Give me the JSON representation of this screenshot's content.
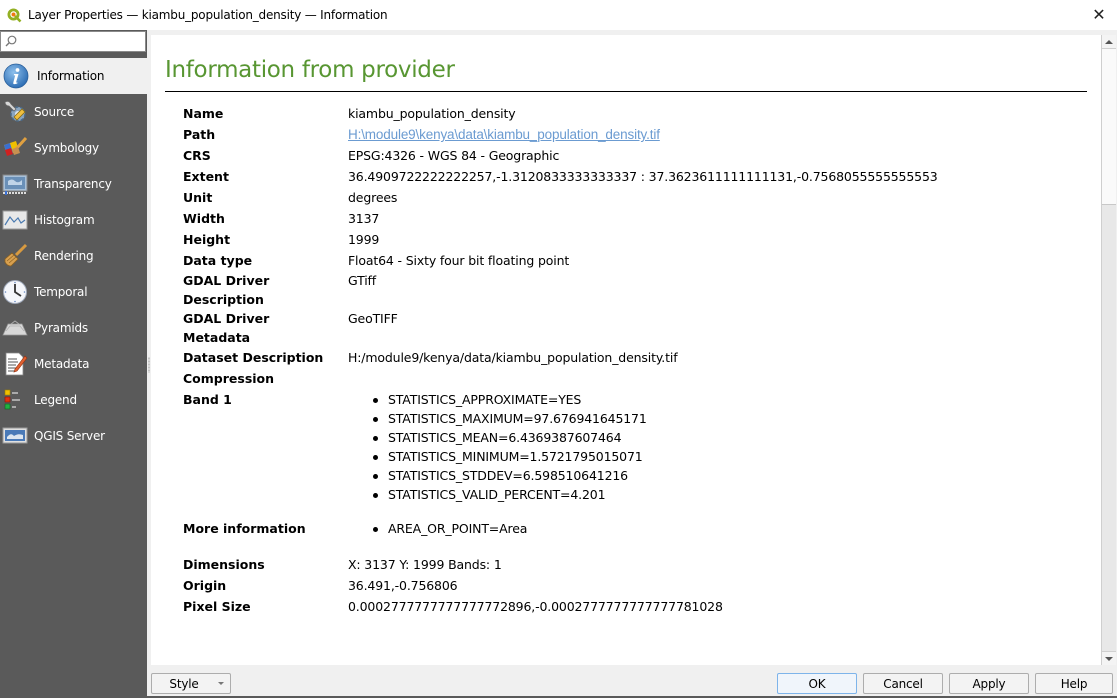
{
  "window": {
    "title": "Layer Properties — kiambu_population_density — Information",
    "app_icon": "qgis-logo-icon",
    "close_icon": "close-icon",
    "close_glyph": "✕"
  },
  "sidebar": {
    "search": {
      "placeholder": "",
      "value": "",
      "icon": "search-icon"
    },
    "items": [
      {
        "label": "Information",
        "icon": "information-icon",
        "selected": true
      },
      {
        "label": "Source",
        "icon": "source-icon",
        "selected": false
      },
      {
        "label": "Symbology",
        "icon": "symbology-icon",
        "selected": false
      },
      {
        "label": "Transparency",
        "icon": "transparency-icon",
        "selected": false
      },
      {
        "label": "Histogram",
        "icon": "histogram-icon",
        "selected": false
      },
      {
        "label": "Rendering",
        "icon": "rendering-icon",
        "selected": false
      },
      {
        "label": "Temporal",
        "icon": "temporal-icon",
        "selected": false
      },
      {
        "label": "Pyramids",
        "icon": "pyramids-icon",
        "selected": false
      },
      {
        "label": "Metadata",
        "icon": "metadata-icon",
        "selected": false
      },
      {
        "label": "Legend",
        "icon": "legend-icon",
        "selected": false
      },
      {
        "label": "QGIS Server",
        "icon": "qgis-server-icon",
        "selected": false
      }
    ]
  },
  "main": {
    "heading": "Information from provider",
    "heading_color": "#589632",
    "link_color": "#6b9bd1",
    "properties": {
      "name": {
        "label": "Name",
        "value": "kiambu_population_density"
      },
      "path": {
        "label": "Path",
        "value": "H:\\module9\\kenya\\data\\kiambu_population_density.tif"
      },
      "crs": {
        "label": "CRS",
        "value": "EPSG:4326 - WGS 84 - Geographic"
      },
      "extent": {
        "label": "Extent",
        "value": "36.4909722222222257,-1.3120833333333337 : 37.3623611111111131,-0.7568055555555553"
      },
      "unit": {
        "label": "Unit",
        "value": "degrees"
      },
      "width": {
        "label": "Width",
        "value": "3137"
      },
      "height": {
        "label": "Height",
        "value": "1999"
      },
      "data_type": {
        "label": "Data type",
        "value": "Float64 - Sixty four bit floating point"
      },
      "gdal_driver_description": {
        "label_line1": "GDAL Driver",
        "label_line2": "Description",
        "value": "GTiff"
      },
      "gdal_driver_metadata": {
        "label_line1": "GDAL Driver",
        "label_line2": "Metadata",
        "value": "GeoTIFF"
      },
      "dataset_description": {
        "label": "Dataset Description",
        "value": "H:/module9/kenya/data/kiambu_population_density.tif"
      },
      "compression": {
        "label": "Compression",
        "value": ""
      },
      "band1": {
        "label": "Band 1",
        "items": [
          "STATISTICS_APPROXIMATE=YES",
          "STATISTICS_MAXIMUM=97.676941645171",
          "STATISTICS_MEAN=6.4369387607464",
          "STATISTICS_MINIMUM=1.5721795015071",
          "STATISTICS_STDDEV=6.598510641216",
          "STATISTICS_VALID_PERCENT=4.201"
        ]
      },
      "more_information": {
        "label": "More information",
        "items": [
          "AREA_OR_POINT=Area"
        ]
      },
      "dimensions": {
        "label": "Dimensions",
        "value": "X: 3137 Y: 1999 Bands: 1"
      },
      "origin": {
        "label": "Origin",
        "value": "36.491,-0.756806"
      },
      "pixel_size": {
        "label": "Pixel Size",
        "value": "0.0002777777777777772896,-0.0002777777777777781028"
      }
    }
  },
  "footer": {
    "style_button": "Style",
    "ok_button": "OK",
    "cancel_button": "Cancel",
    "apply_button": "Apply",
    "help_button": "Help"
  }
}
